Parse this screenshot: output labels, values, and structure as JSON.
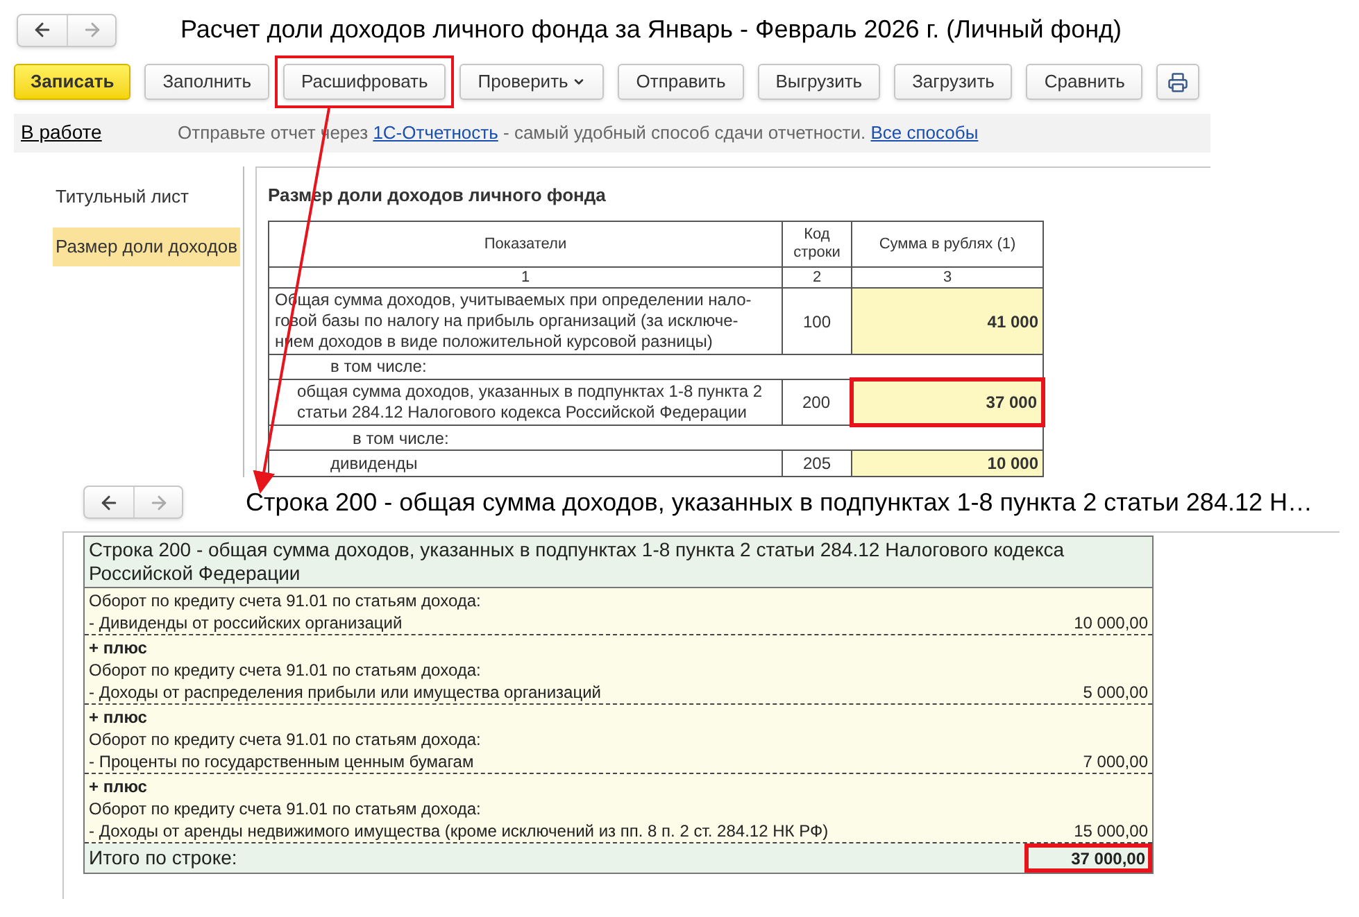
{
  "window": {
    "title": "Расчет доли доходов личного фонда за Январь - Февраль 2026 г. (Личный фонд)"
  },
  "toolbar": [
    {
      "kind": "primary",
      "label": "Записать",
      "highlighted": false
    },
    {
      "kind": "plain",
      "label": "Заполнить",
      "highlighted": false
    },
    {
      "kind": "plain",
      "label": "Расшифровать",
      "highlighted": true
    },
    {
      "kind": "dropdown",
      "label": "Проверить",
      "highlighted": false
    },
    {
      "kind": "plain",
      "label": "Отправить",
      "highlighted": false
    },
    {
      "kind": "plain",
      "label": "Выгрузить",
      "highlighted": false
    },
    {
      "kind": "plain",
      "label": "Загрузить",
      "highlighted": false
    },
    {
      "kind": "plain",
      "label": "Сравнить",
      "highlighted": false
    },
    {
      "kind": "print",
      "highlighted": false
    }
  ],
  "status_bar": {
    "state": "В работе",
    "text_before": "Отправьте отчет через",
    "link": "1С-Отчетность",
    "text_after": "- самый удобный способ сдачи отчетности.",
    "link_all": "Все способы"
  },
  "sidebar": {
    "items": [
      {
        "label": "Титульный лист",
        "selected": false
      },
      {
        "label": "Размер доли доходов",
        "selected": true
      }
    ]
  },
  "section_title": "Размер доли доходов личного фонда",
  "table": {
    "columns": [
      "Показатели",
      "Код строки",
      "Сумма в рублях (1)"
    ],
    "column_numbers": [
      "1",
      "2",
      "3"
    ],
    "rows": [
      {
        "kind": "value",
        "label": "Общая сумма доходов, учитываемых при определении нало-\nговой базы по налогу на прибыль организаций (за исключе-\nнием доходов в виде положительной курсовой разницы)",
        "code": "100",
        "amount": "41 000",
        "highlighted": false,
        "children": [
          {
            "kind": "note",
            "label": "в том числе:"
          },
          {
            "kind": "value",
            "label": "общая сумма доходов, указанных в подпунктах 1-8 пункта 2\nстатьи 284.12 Налогового кодекса Российской Федерации",
            "code": "200",
            "amount": "37 000",
            "highlighted": true,
            "children": [
              {
                "kind": "note",
                "label": "в том числе:"
              },
              {
                "kind": "value",
                "label": "дивиденды",
                "code": "205",
                "amount": "10 000",
                "highlighted": false
              }
            ]
          }
        ]
      }
    ]
  },
  "detail": {
    "title": "Строка 200 - общая сумма доходов, указанных в подпунктах 1-8 пункта 2 статьи 284.12 Н…",
    "header": "Строка 200 - общая сумма доходов, указанных в подпунктах 1-8 пункта 2 статьи 284.12 Налогового кодекса Российской Федерации",
    "entries": [
      {
        "account": "Оборот по кредиту счета 91.01 по статьям дохода:",
        "item": "- Дивиденды от российских организаций",
        "amount": "10 000,00"
      },
      {
        "prefix": "+ плюс",
        "account": "Оборот по кредиту счета 91.01 по статьям дохода:",
        "item": "- Доходы от распределения прибыли или имущества организаций",
        "amount": "5 000,00"
      },
      {
        "prefix": "+ плюс",
        "account": "Оборот по кредиту счета 91.01 по статьям дохода:",
        "item": "- Проценты по государственным ценным бумагам",
        "amount": "7 000,00"
      },
      {
        "prefix": "+ плюс",
        "account": "Оборот по кредиту счета 91.01 по статьям дохода:",
        "item": "- Доходы от аренды недвижимого имущества (кроме исключений из пп. 8 п. 2 ст. 284.12 НК РФ)",
        "amount": "15 000,00"
      }
    ],
    "total": {
      "label": "Итого по строке:",
      "amount": "37 000,00",
      "highlighted": true
    }
  }
}
